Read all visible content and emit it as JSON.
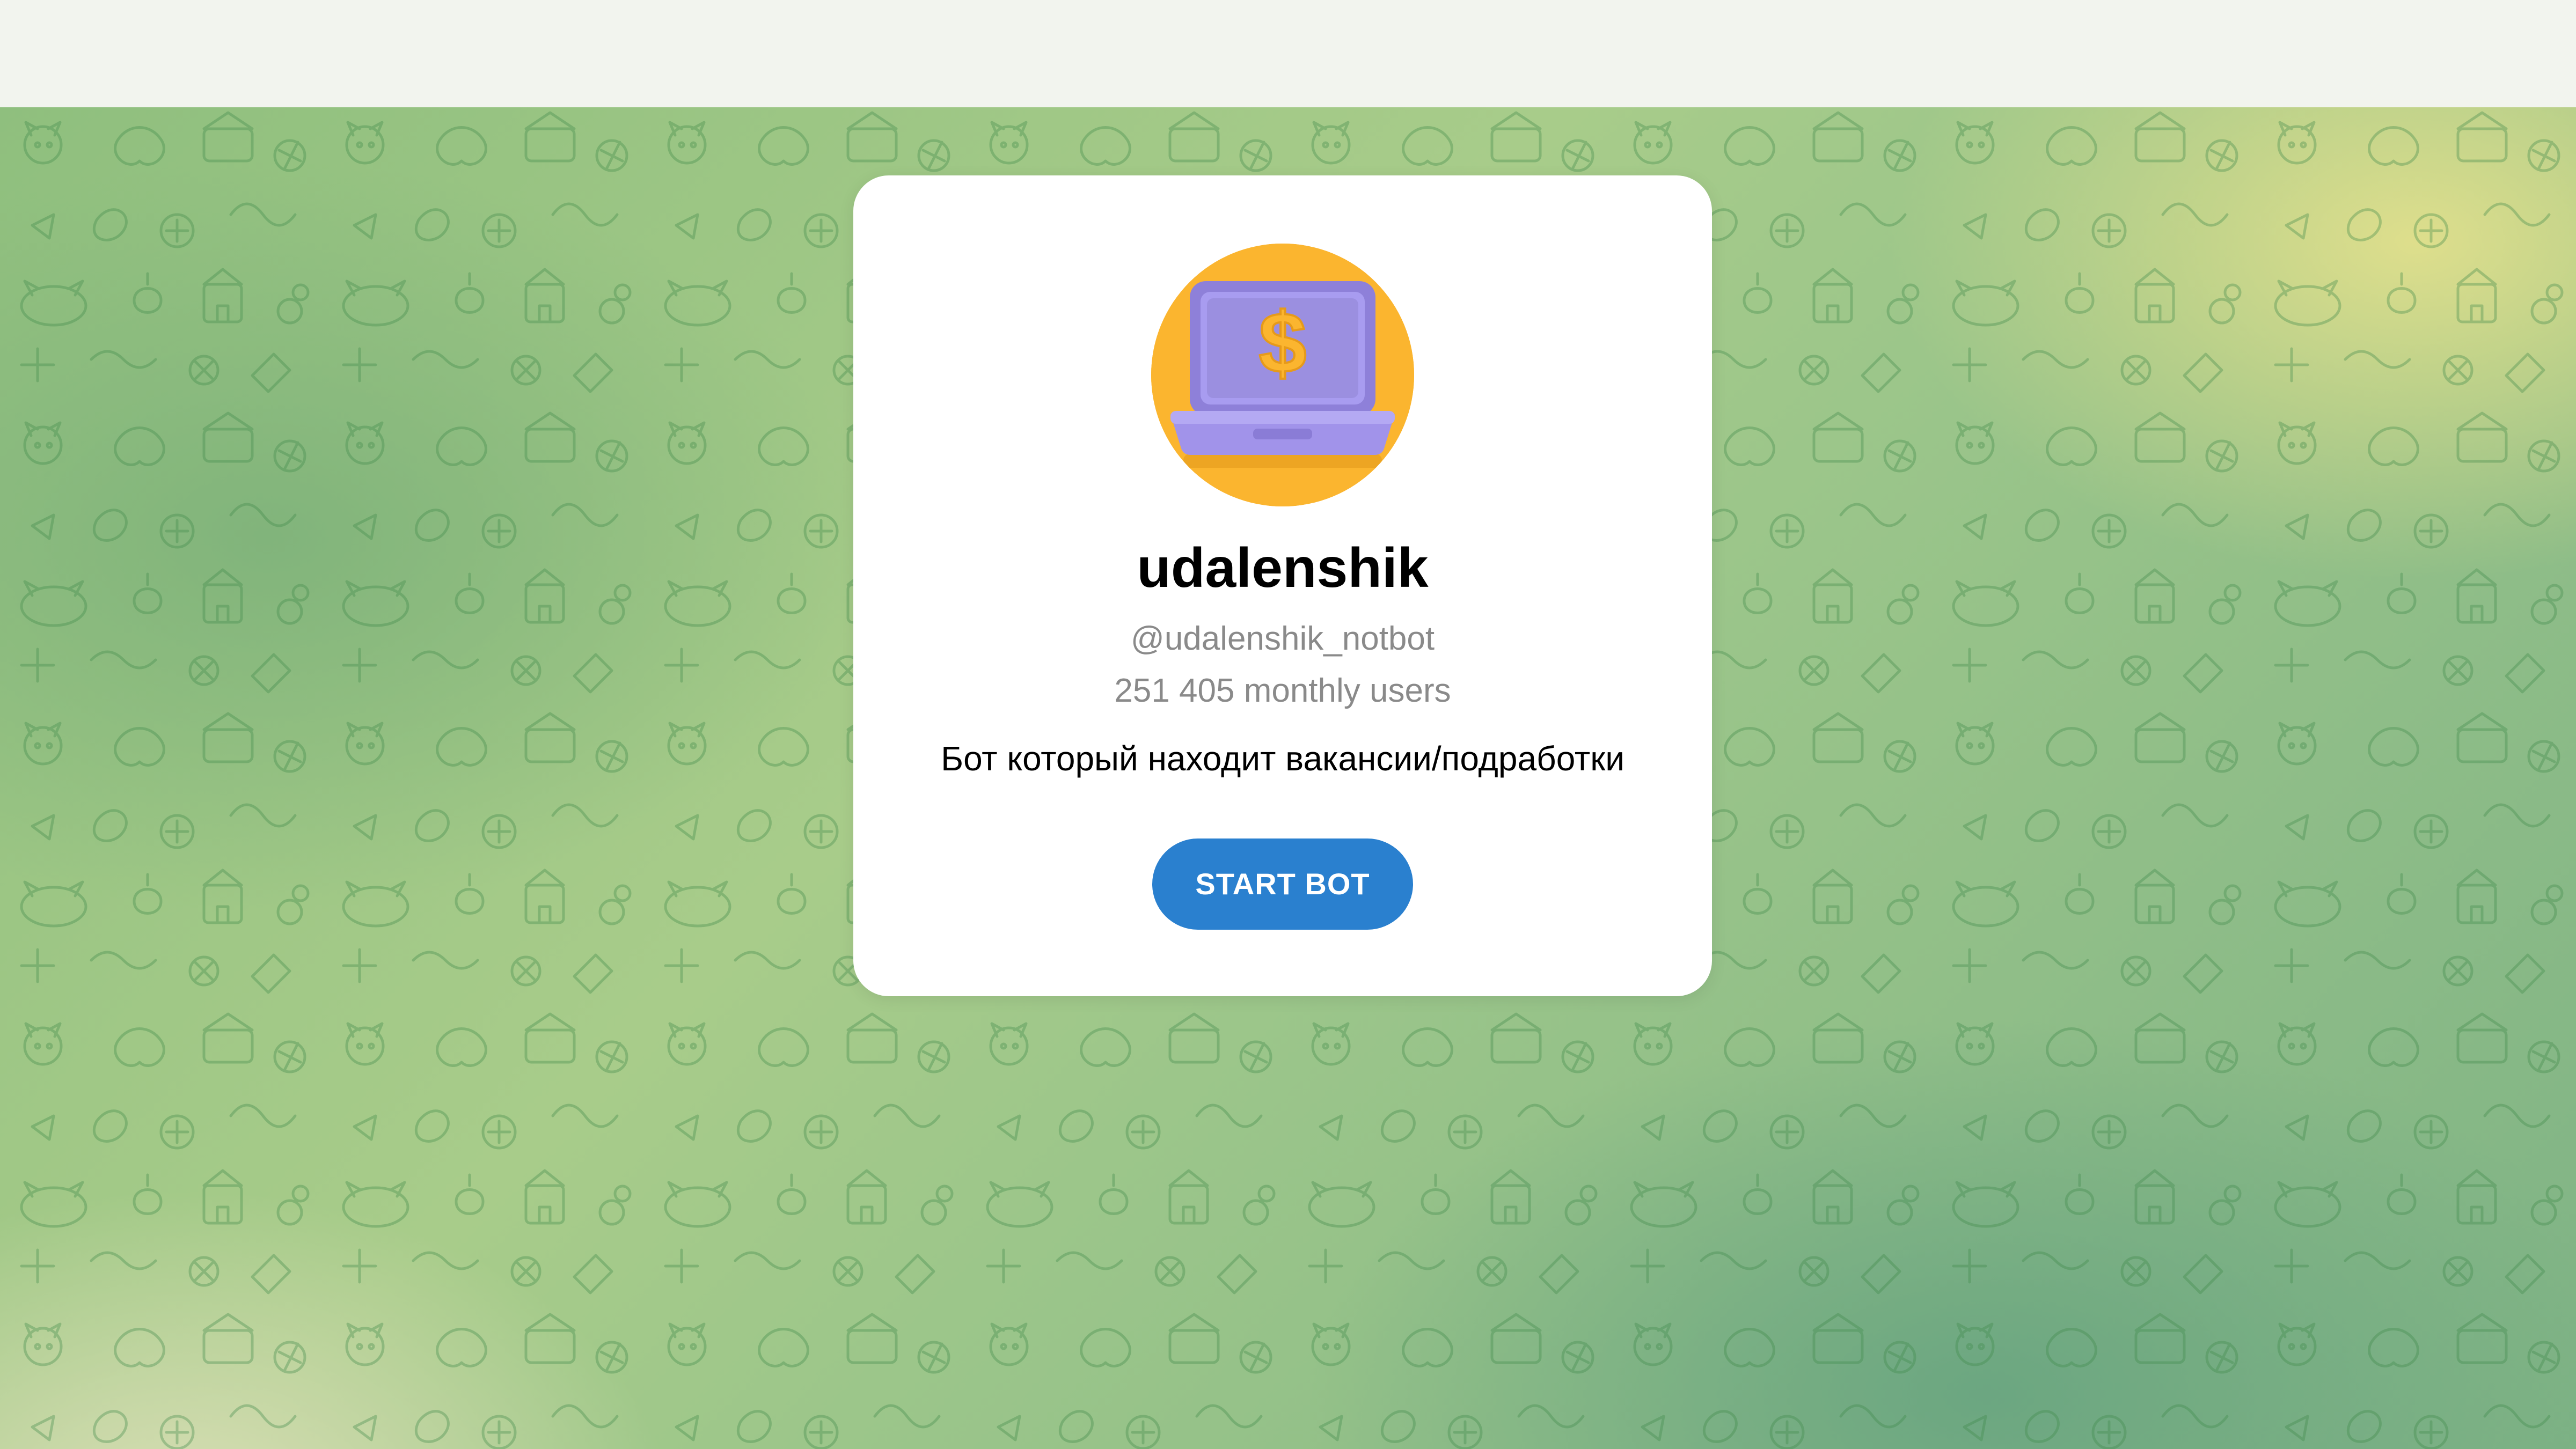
{
  "bot": {
    "name": "udalenshik",
    "username": "@udalenshik_notbot",
    "monthly_users": "251 405 monthly users",
    "description": "Бот который находит вакансии/подработки",
    "start_button_label": "START BOT",
    "avatar_symbol": "$",
    "avatar_icon": "laptop-dollar-icon"
  },
  "colors": {
    "top_bar": "#f2f4ee",
    "card_bg": "#ffffff",
    "button_bg": "#2a80cf",
    "button_text": "#ffffff",
    "avatar_bg": "#fbb52f",
    "laptop": "#9b8fe0",
    "secondary_text": "#8a8a8a"
  },
  "background": {
    "pattern": "doodle-pattern-cats-dogs"
  }
}
